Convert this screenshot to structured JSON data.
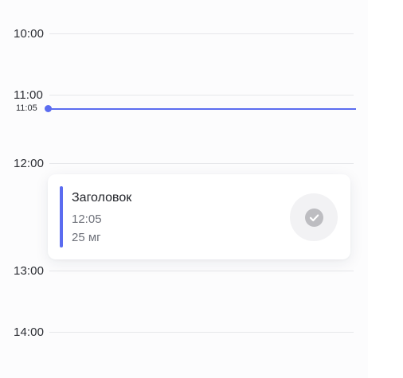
{
  "timeline": {
    "hours": [
      {
        "label": "10:00"
      },
      {
        "label": "11:00"
      },
      {
        "label": "12:00"
      },
      {
        "label": "13:00"
      },
      {
        "label": "14:00"
      }
    ],
    "current_time": "11:05"
  },
  "event": {
    "title": "Заголовок",
    "time": "12:05",
    "dose": "25 мг",
    "status_icon": "check-circle-icon"
  },
  "colors": {
    "accent": "#5b6cf0",
    "line": "#e6e7ea",
    "check_icon": "#bdbdc1"
  }
}
